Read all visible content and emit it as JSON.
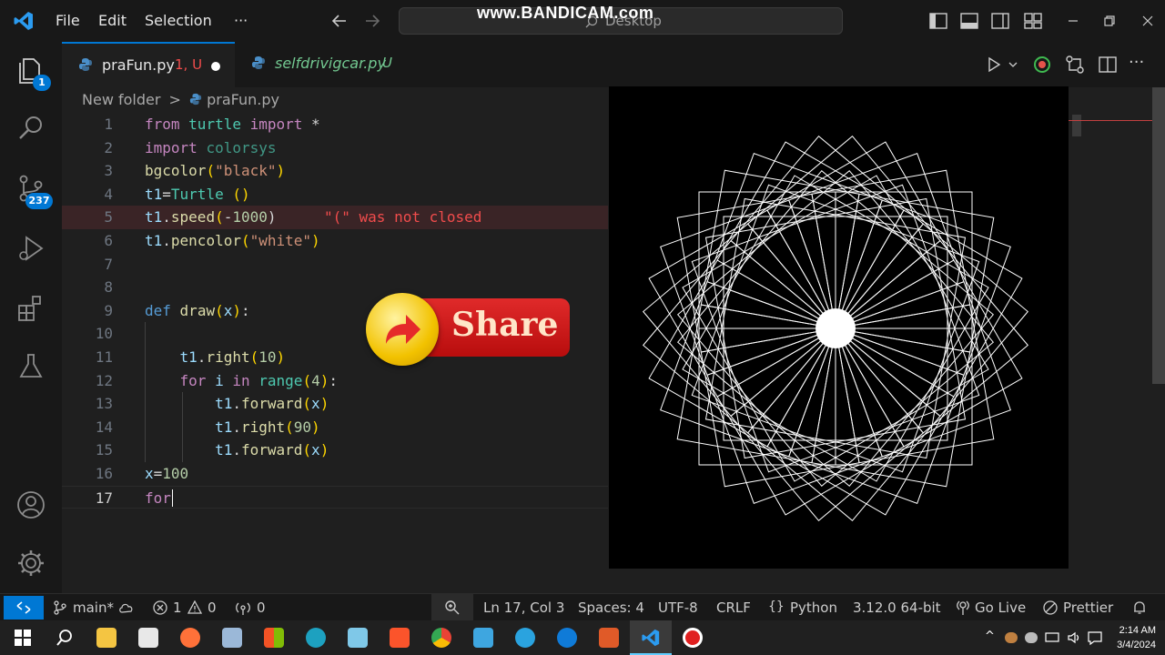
{
  "titlebar": {
    "menus": [
      "File",
      "Edit",
      "Selection",
      "···"
    ],
    "search_text": "Desktop",
    "watermark": "www.BANDICAM.com"
  },
  "activity": {
    "explorer_badge": "1",
    "scm_badge": "237"
  },
  "tabs": [
    {
      "name": "praFun.py",
      "flag": "1, U",
      "italic": false
    },
    {
      "name": "selfdrivigcar.py",
      "flag": "U",
      "italic": true
    }
  ],
  "breadcrumb": {
    "folder": "New folder",
    "sep": ">",
    "file": "praFun.py"
  },
  "editor": {
    "line_numbers": [
      "1",
      "2",
      "3",
      "4",
      "5",
      "6",
      "7",
      "8",
      "9",
      "10",
      "11",
      "12",
      "13",
      "14",
      "15",
      "16",
      "17"
    ],
    "error_hint": "\"(\" was not closed"
  },
  "overlay": {
    "share_label": "Share"
  },
  "statusbar": {
    "branch": "main*",
    "errors": "1",
    "warnings": "0",
    "ports": "0",
    "position": "Ln 17, Col 3",
    "spaces": "Spaces: 4",
    "encoding": "UTF-8",
    "eol": "CRLF",
    "language": "Python",
    "interpreter": "3.12.0 64-bit",
    "golive": "Go Live",
    "prettier": "Prettier"
  },
  "taskbar": {
    "time": "2:14 AM",
    "date": "3/4/2024"
  },
  "colors": {
    "accent": "#0078d4",
    "error": "#f14c4c",
    "share_red": "#c8102e",
    "share_yellow": "#f2c200"
  }
}
